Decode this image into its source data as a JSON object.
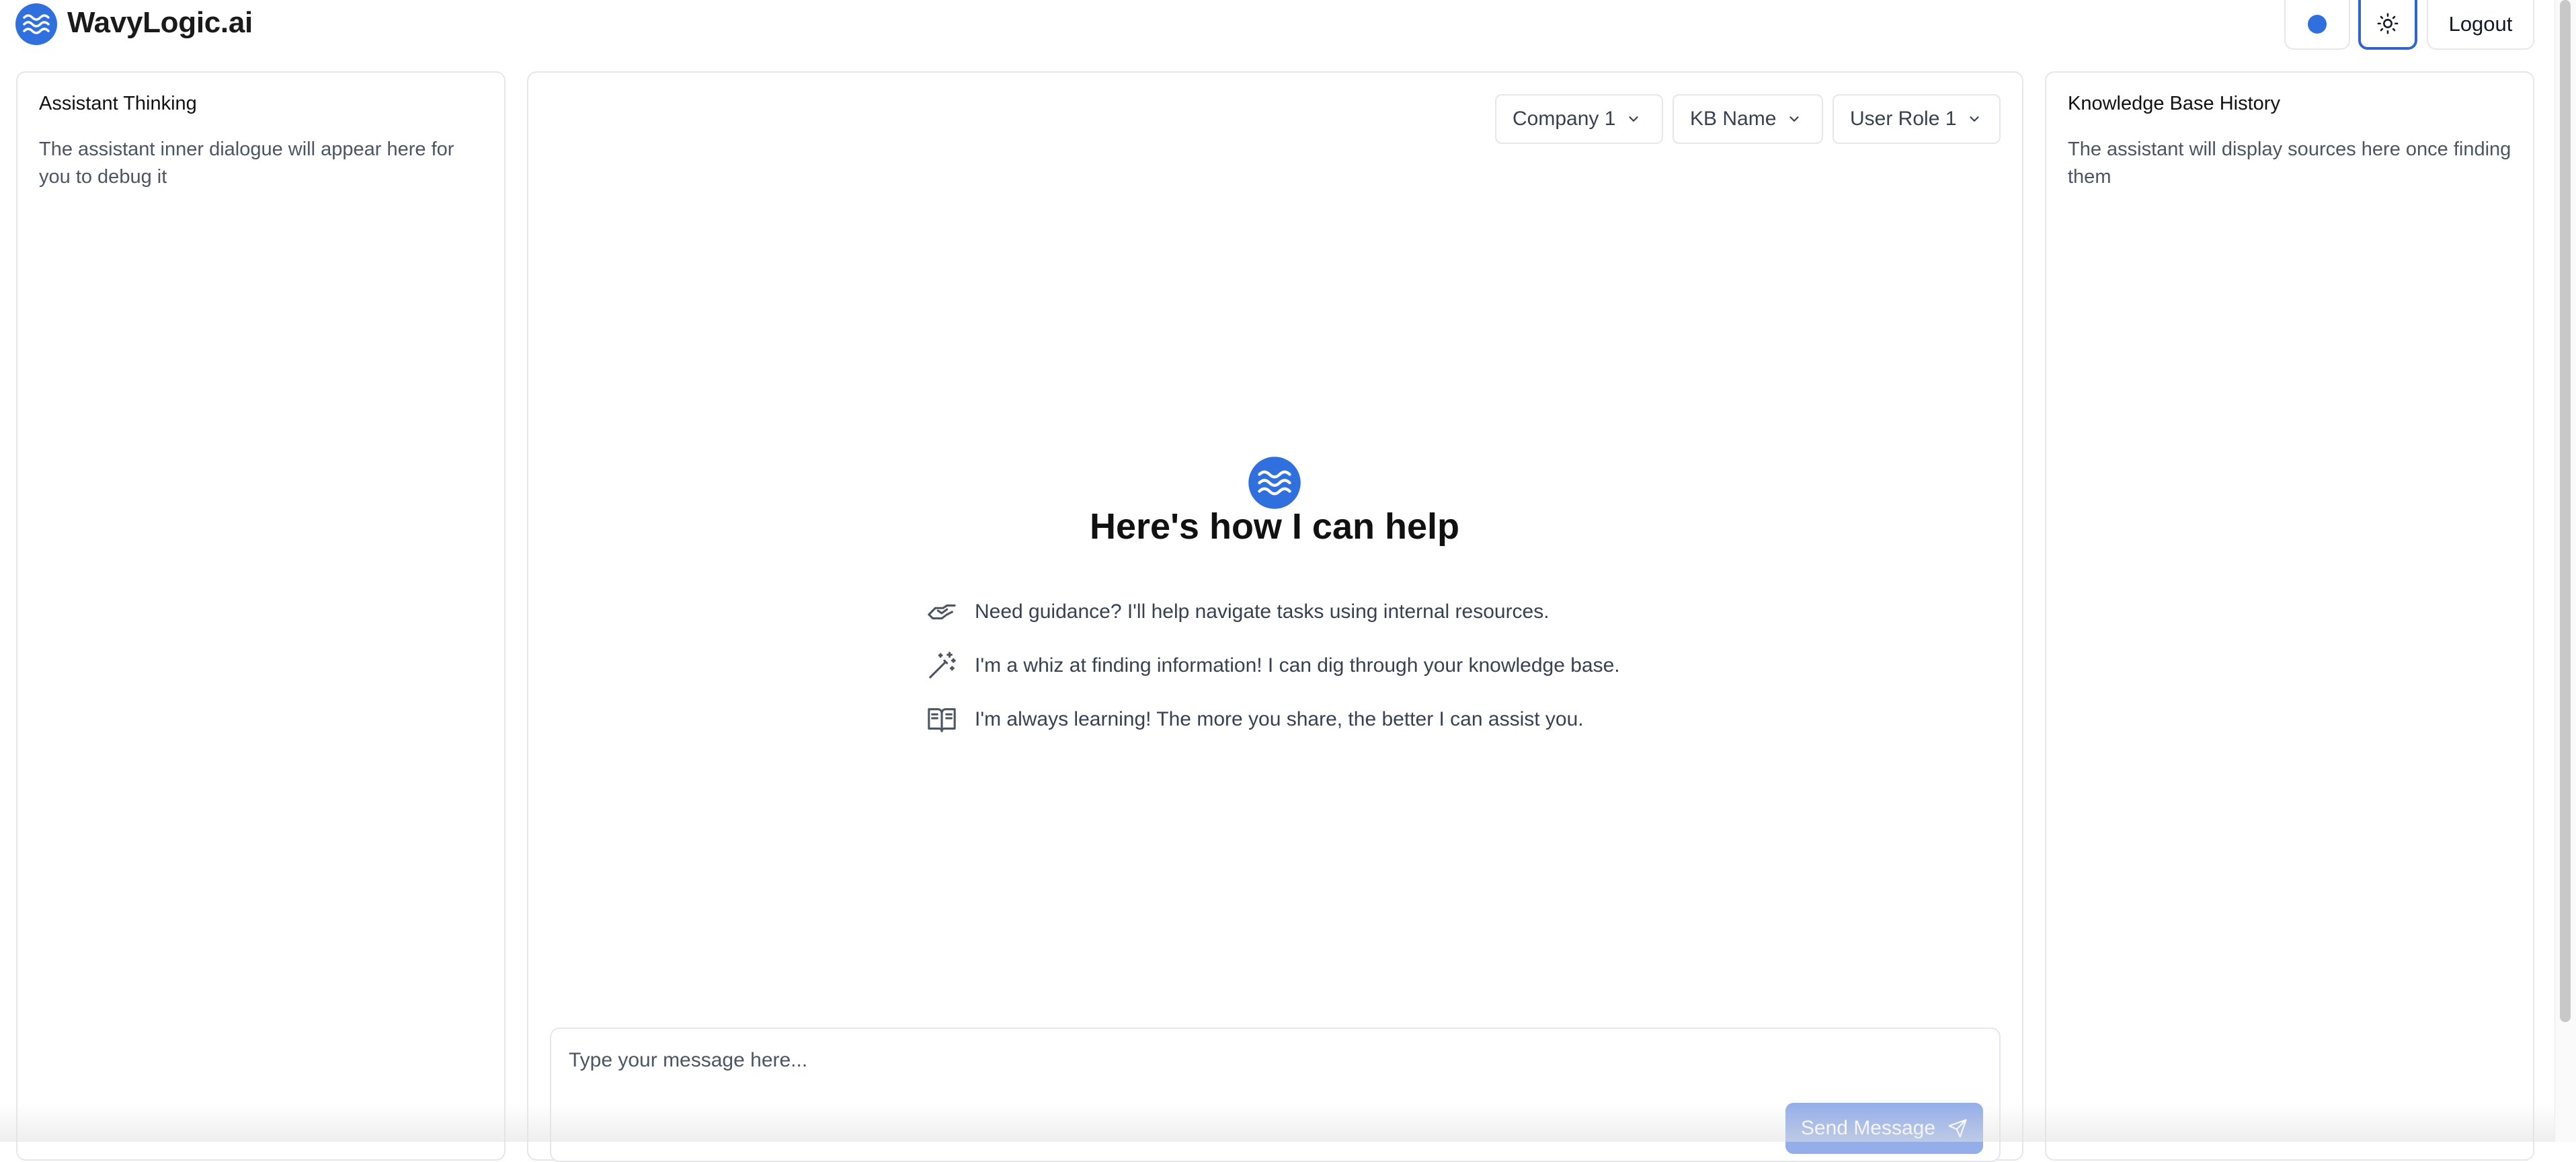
{
  "app": {
    "brand": "WavyLogic.ai",
    "accent_color": "#2f6fde",
    "logo_icon": "waves-logo-icon"
  },
  "header": {
    "status_color": "#2f6fde",
    "theme_icon": "sun-icon",
    "logout_label": "Logout"
  },
  "left_panel": {
    "title": "Assistant Thinking",
    "description": "The assistant inner dialogue will appear here for you to debug it"
  },
  "right_panel": {
    "title": "Knowledge Base History",
    "description": "The assistant will display sources here once finding them"
  },
  "filters": {
    "company": "Company 1",
    "kb": "KB Name",
    "role": "User Role 1"
  },
  "intro": {
    "title": "Here's how I can help",
    "items": [
      {
        "icon": "handshake-icon",
        "text": "Need guidance? I'll help navigate tasks using internal resources."
      },
      {
        "icon": "magic-wand-icon",
        "text": "I'm a whiz at finding information! I can dig through your knowledge base."
      },
      {
        "icon": "open-book-icon",
        "text": "I'm always learning! The more you share, the better I can assist you."
      }
    ]
  },
  "composer": {
    "placeholder": "Type your message here...",
    "send_label": "Send Message",
    "send_icon": "send-icon"
  }
}
